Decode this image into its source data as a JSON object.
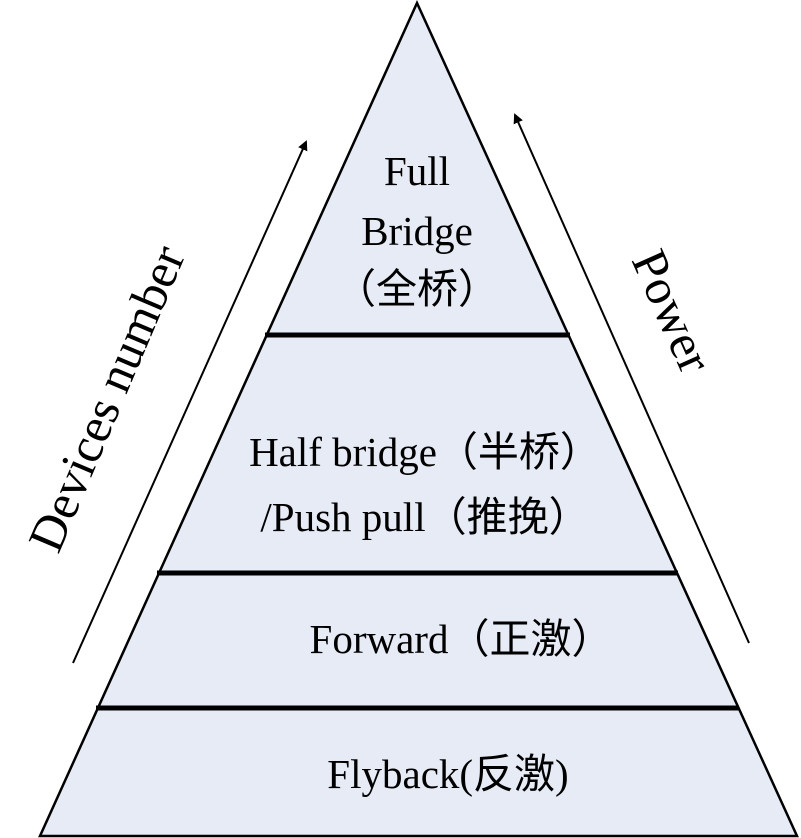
{
  "colors": {
    "fill": "#e6ebf5",
    "stroke": "#000000"
  },
  "tiers": [
    {
      "id": "full-bridge",
      "lines": [
        "Full",
        "Bridge",
        "（全桥）"
      ]
    },
    {
      "id": "half-bridge-push-pull",
      "lines": [
        "Half bridge（半桥）",
        "/Push pull（推挽）"
      ]
    },
    {
      "id": "forward",
      "lines": [
        "Forward（正激）"
      ]
    },
    {
      "id": "flyback",
      "lines": [
        "Flyback(反激)"
      ]
    }
  ],
  "left_arrow_label": "Devices number",
  "right_arrow_label": "Power"
}
